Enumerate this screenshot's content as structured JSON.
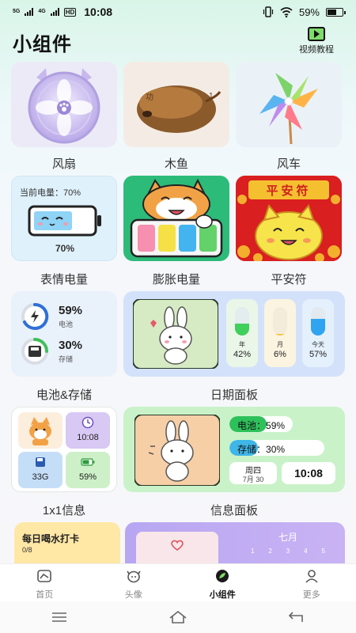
{
  "status": {
    "sig1": "5G",
    "sig2": "4G",
    "hd": "HD",
    "time": "10:08",
    "battery_pct": "59%"
  },
  "header": {
    "title": "小组件",
    "video_tutorial": "视频教程"
  },
  "widgets": {
    "fan": "风扇",
    "wooden_fish": "木鱼",
    "windmill": "风车",
    "emoji_battery": "表情电量",
    "puff_battery": "膨胀电量",
    "peace_charm": "平安符",
    "battery_storage": "电池&存储",
    "date_panel": "日期面板",
    "one_by_one": "1x1信息",
    "info_panel": "信息面板"
  },
  "fish_text": {
    "left": "功",
    "right": "1"
  },
  "emoji_card": {
    "current_label": "当前电量：",
    "current_value": "70%",
    "bottom_value": "70%"
  },
  "peace_card": {
    "title": "平安符"
  },
  "bs_card": {
    "battery_value": "59%",
    "battery_label": "电池",
    "storage_value": "30%",
    "storage_label": "存储"
  },
  "date_card": {
    "year_label": "年",
    "year_value": "42%",
    "month_label": "月",
    "month_value": "6%",
    "today_label": "今天",
    "today_value": "57%"
  },
  "one_card": {
    "time": "10:08",
    "storage": "33G",
    "battery": "59%"
  },
  "info_card": {
    "battery_label": "电池：",
    "battery_value": "59%",
    "storage_label": "存储：",
    "storage_value": "30%",
    "weekday": "周四",
    "date": "7月 30",
    "time": "10:08"
  },
  "water_card": {
    "title": "每日喝水打卡",
    "progress": "0/8"
  },
  "cal_card": {
    "month": "七月",
    "days": [
      "1",
      "2",
      "3",
      "4",
      "5"
    ]
  },
  "tabs": [
    {
      "label": "首页"
    },
    {
      "label": "头像"
    },
    {
      "label": "小组件"
    },
    {
      "label": "更多"
    }
  ],
  "colors": {
    "accent_green": "#2dbb7a",
    "peace_red": "#d91f1f",
    "date_blue": "#d3e2fa",
    "info_green": "#c9f2c9",
    "water_yellow": "#ffe7a6",
    "cal_purple": "#b7a6f2"
  }
}
